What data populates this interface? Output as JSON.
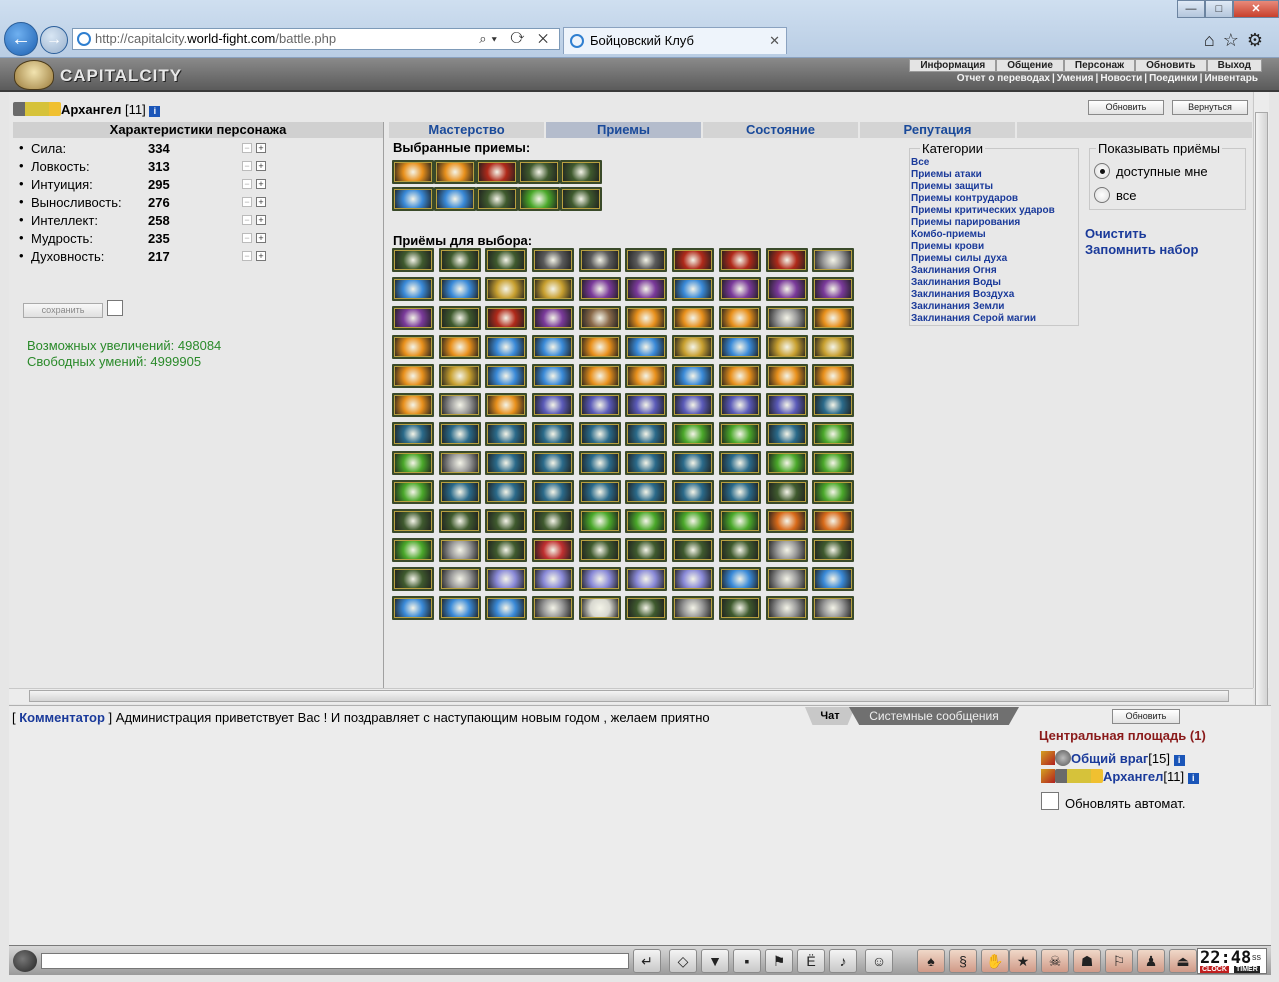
{
  "browser": {
    "url_prefix": "http://capitalcity.",
    "url_host": "world-fight.com",
    "url_path": "/battle.php",
    "tab_title": "Бойцовский Клуб"
  },
  "header": {
    "logo_text": "CAPITALCITY",
    "top_menu": [
      "Информация",
      "Общение",
      "Персонаж",
      "Обновить",
      "Выход"
    ],
    "sub_menu": [
      "Отчет о переводах",
      "Умения",
      "Новости",
      "Поединки",
      "Инвентарь"
    ]
  },
  "character": {
    "name": "Архангел",
    "level": "[11]",
    "refresh_label": "Обновить",
    "back_label": "Вернуться"
  },
  "stats": {
    "title": "Характеристики персонажа",
    "items": [
      {
        "name": "Сила:",
        "value": "334"
      },
      {
        "name": "Ловкость:",
        "value": "313"
      },
      {
        "name": "Интуиция:",
        "value": "295"
      },
      {
        "name": "Выносливость:",
        "value": "276"
      },
      {
        "name": "Интеллект:",
        "value": "258"
      },
      {
        "name": "Мудрость:",
        "value": "235"
      },
      {
        "name": "Духовность:",
        "value": "217"
      }
    ],
    "save_label": "сохранить",
    "possible_increases": "Возможных увеличений: 498084",
    "free_skills": "Свободных умений: 4999905"
  },
  "tabs": [
    "Мастерство",
    "Приемы",
    "Состояние",
    "Репутация"
  ],
  "selected_label": "Выбранные приемы:",
  "choice_label": "Приёмы для выбора:",
  "categories": {
    "legend": "Категории",
    "items": [
      "Все",
      "Приемы атаки",
      "Приемы защиты",
      "Приемы контрударов",
      "Приемы критических ударов",
      "Приемы парирования",
      "Комбо-приемы",
      "Приемы крови",
      "Приемы силы духа",
      "Заклинания Огня",
      "Заклинания Воды",
      "Заклинания Воздуха",
      "Заклинания Земли",
      "Заклинания Серой магии"
    ]
  },
  "show_filter": {
    "legend": "Показывать приёмы",
    "option_available": "доступные мне",
    "option_all": "все",
    "selected": "доступные мне"
  },
  "actions": {
    "clear_label": "Очистить",
    "remember_label": "Запомнить набор"
  },
  "selected_skills": [
    "fire",
    "fire",
    "red",
    "green-dark",
    "green-dark",
    "ice",
    "ice",
    "green-dark",
    "green",
    "green-dark"
  ],
  "skill_grid": [
    "green-dark",
    "green-dark",
    "green-dark",
    "grey-dark",
    "grey-dark",
    "grey-dark",
    "red",
    "red",
    "red",
    "grey",
    "ice",
    "ice",
    "gold",
    "gold",
    "purple",
    "purple",
    "ice",
    "purple",
    "purple",
    "purple",
    "purple",
    "green-dark",
    "red",
    "purple",
    "brown",
    "fire",
    "fire",
    "fire",
    "grey",
    "fire",
    "fire",
    "fire",
    "ice",
    "ice",
    "fire",
    "ice",
    "gold",
    "ice",
    "gold",
    "gold",
    "fire",
    "gold",
    "ice",
    "ice",
    "fire",
    "fire",
    "ice",
    "fire",
    "fire",
    "fire",
    "fire",
    "grey",
    "fire",
    "violet",
    "violet",
    "violet",
    "violet",
    "violet",
    "violet",
    "teal",
    "teal",
    "teal",
    "teal",
    "teal",
    "teal",
    "teal",
    "green",
    "green",
    "teal",
    "green",
    "green",
    "grey",
    "teal",
    "teal",
    "teal",
    "teal",
    "teal",
    "teal",
    "green",
    "green",
    "green",
    "teal",
    "teal",
    "teal",
    "teal",
    "teal",
    "teal",
    "teal",
    "green-dark",
    "green",
    "green-dark",
    "green-dark",
    "green-dark",
    "green-dark",
    "green",
    "green",
    "green",
    "green",
    "orange",
    "orange",
    "green",
    "grey",
    "green-dark",
    "heart",
    "green-dark",
    "green-dark",
    "green-dark",
    "green-dark",
    "grey",
    "green-dark",
    "green-dark",
    "grey",
    "lavender",
    "lavender",
    "lavender",
    "lavender",
    "lavender",
    "ice",
    "grey",
    "ice",
    "ice",
    "ice",
    "ice",
    "grey",
    "white",
    "green-dark",
    "grey",
    "green-dark",
    "grey",
    "grey"
  ],
  "skill_colors": {
    "fire": "#e8901c",
    "red": "#b02a1a",
    "green-dark": "#3f5a2e",
    "green": "#4aa82a",
    "ice": "#3a8ad8",
    "gold": "#c8a030",
    "purple": "#7a3a9a",
    "grey": "#9a9a9a",
    "grey-dark": "#5a5a5a",
    "brown": "#8a6a4a",
    "violet": "#5a5ab8",
    "teal": "#2a6a8a",
    "orange": "#d86a1a",
    "heart": "#c03030",
    "lavender": "#8a8ad8",
    "white": "#d8d8d0"
  },
  "chat": {
    "author": "Комментатор",
    "message": "Администрация приветствует Вас ! И поздравляет с наступающим новым годом , желаем приятно",
    "tab_chat": "Чат",
    "tab_system": "Системные сообщения",
    "refresh_label": "Обновить",
    "room_title": "Центральная площадь (1)",
    "users": [
      {
        "name": "Общий враг",
        "level": "[15]"
      },
      {
        "name": "Архангел",
        "level": "[11]"
      }
    ],
    "auto_refresh_label": "Обновлять автомат."
  },
  "clock": {
    "time": "22:48",
    "seconds": "ss",
    "clock_label": "CLOCK",
    "timer_label": "TIMER"
  }
}
